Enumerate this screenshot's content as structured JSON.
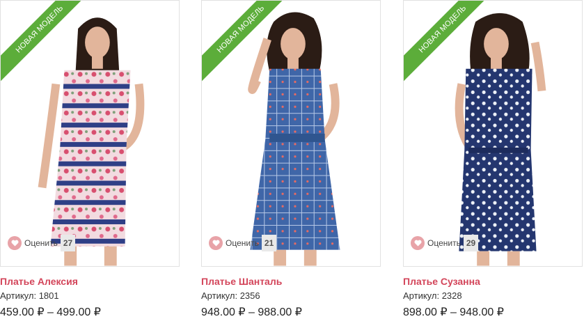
{
  "ribbon_text": "НОВАЯ МОДЕЛЬ",
  "accent_colors": {
    "ribbon": "#5cad3a",
    "title": "#d3455a",
    "heart": "#e8a3a8"
  },
  "products": [
    {
      "title": "Платье Алексия",
      "sku": "Артикул: 1801",
      "price": "459.00 ₽ – 499.00 ₽",
      "rate_label": "Оценить",
      "rate_count": "27",
      "image": "woman-in-floral-striped-dress"
    },
    {
      "title": "Платье Шанталь",
      "sku": "Артикул: 2356",
      "price": "948.00 ₽ – 988.00 ₽",
      "rate_label": "Оценить",
      "rate_count": "21",
      "image": "woman-in-blue-checked-dress"
    },
    {
      "title": "Платье Сузанна",
      "sku": "Артикул: 2328",
      "price": "898.00 ₽ – 948.00 ₽",
      "rate_label": "Оценить",
      "rate_count": "29",
      "image": "woman-in-navy-floral-dress"
    }
  ]
}
